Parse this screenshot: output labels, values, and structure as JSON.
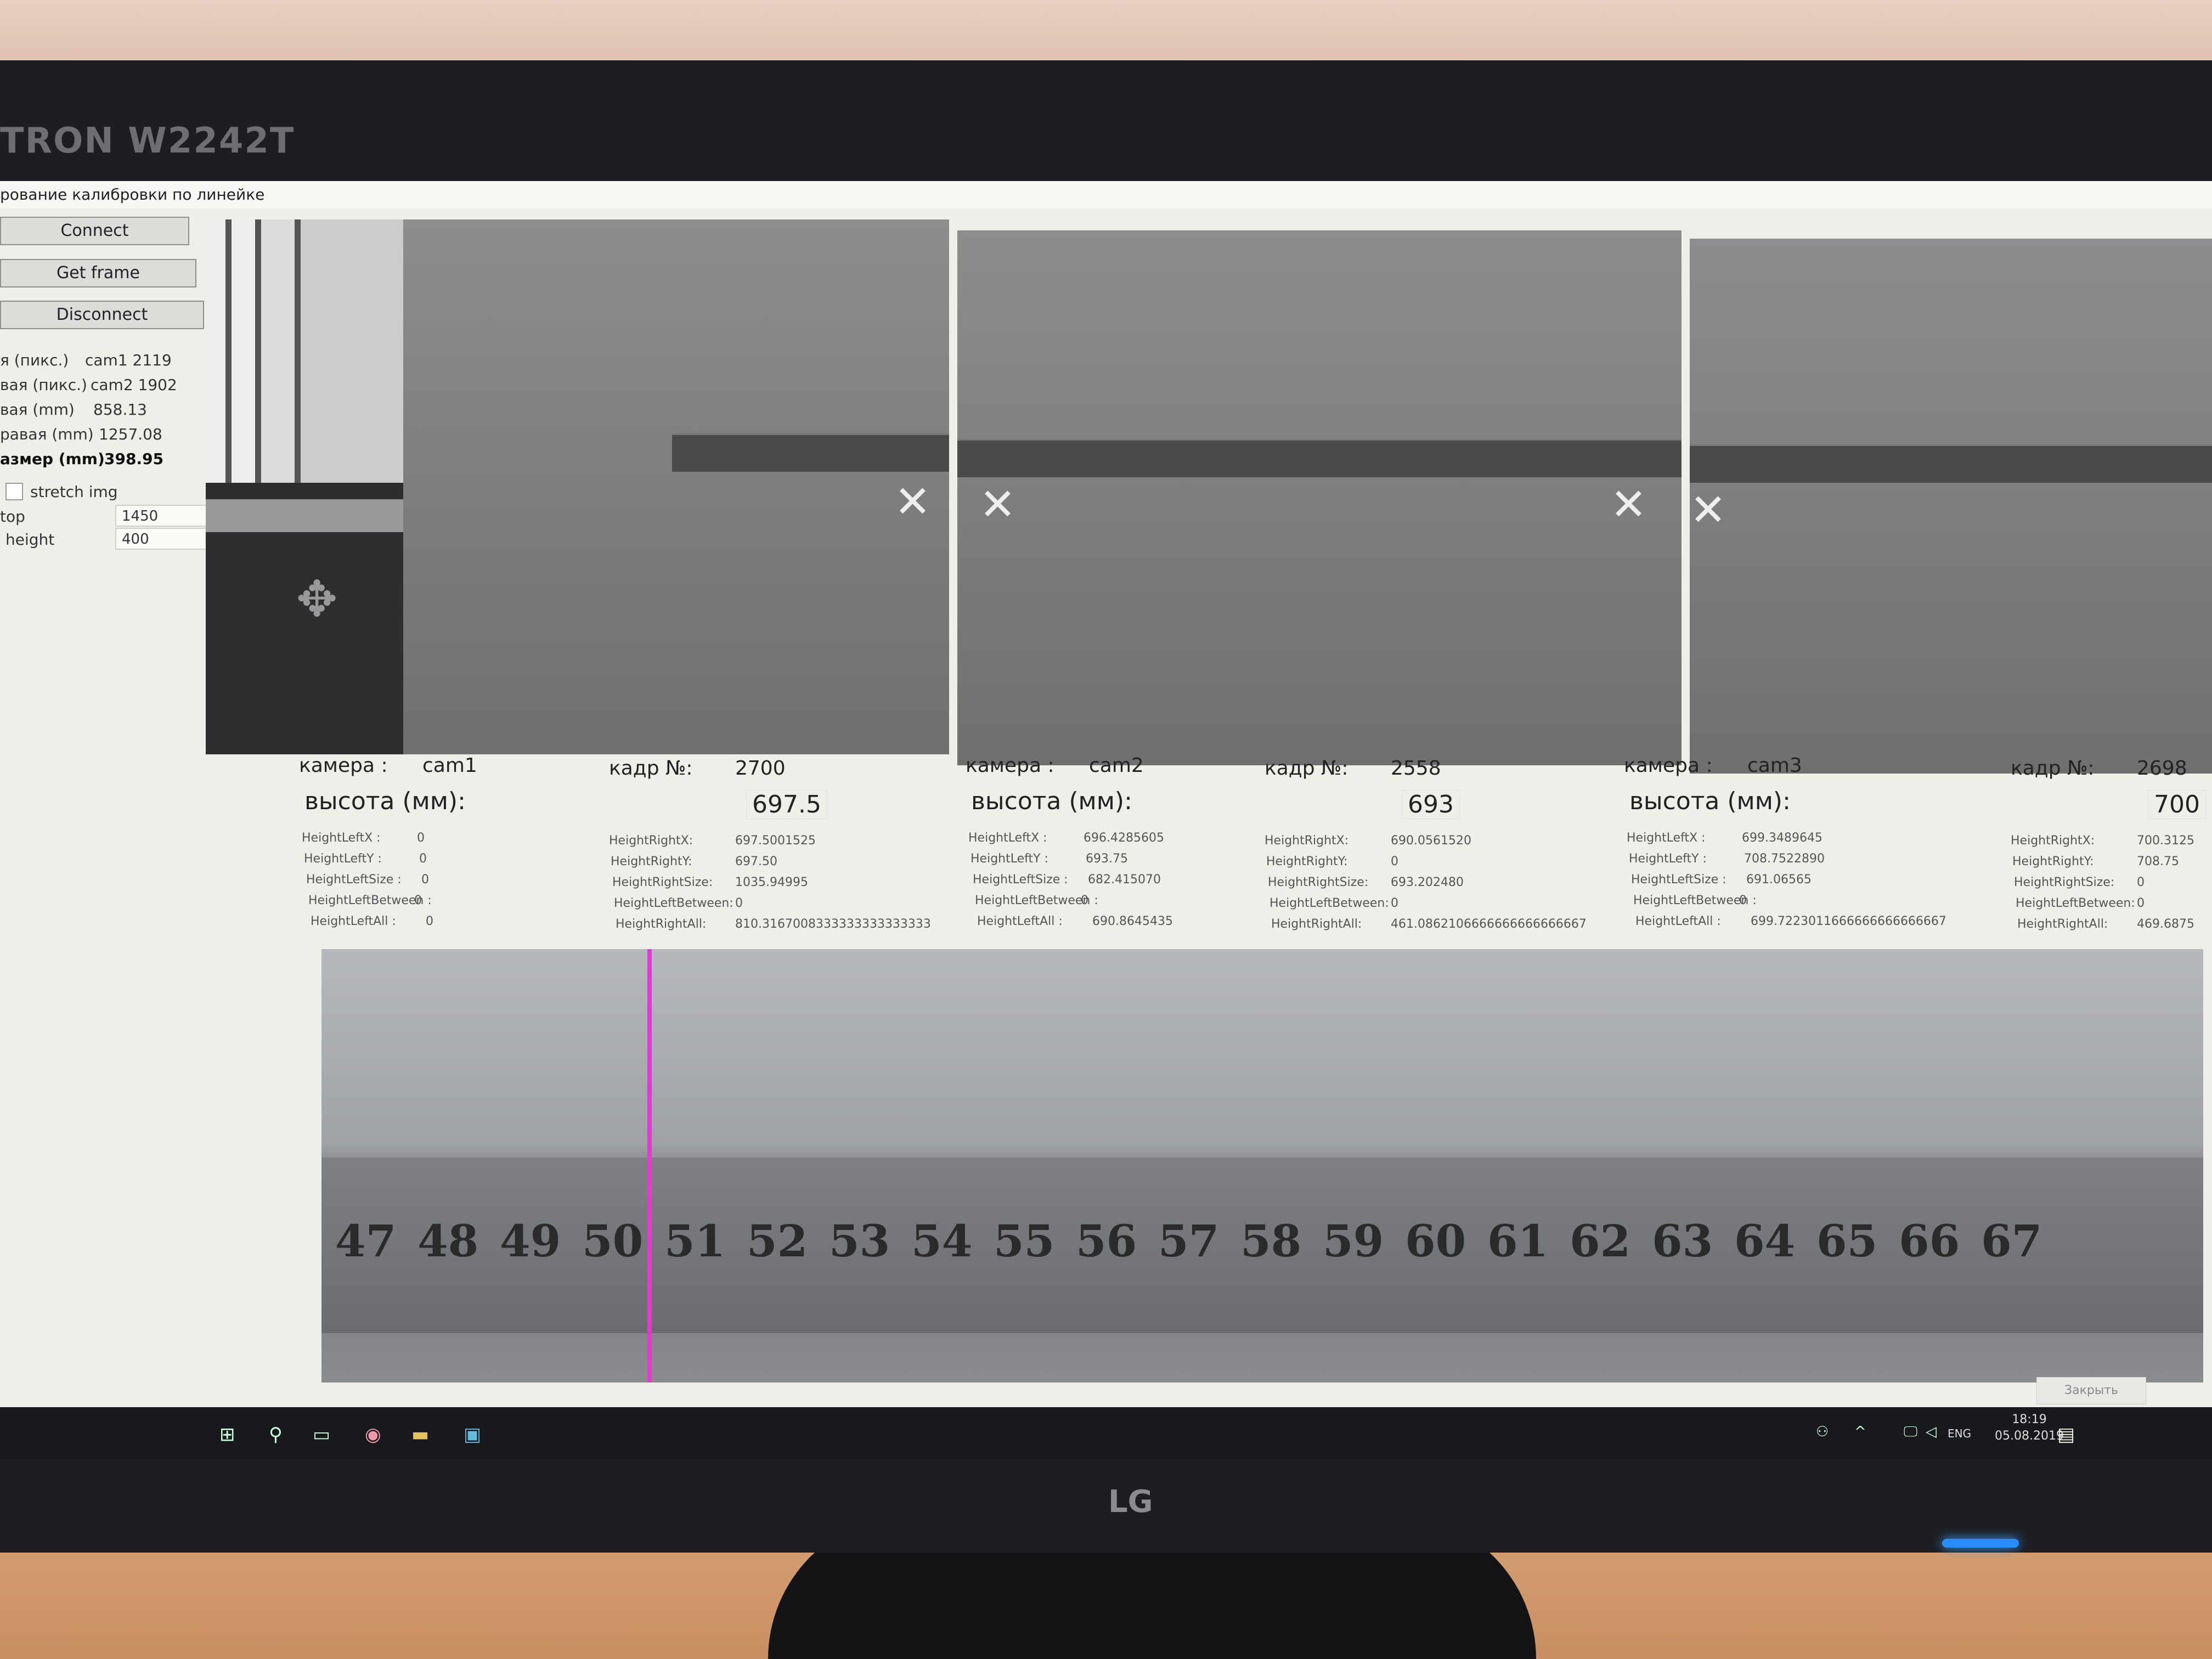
{
  "monitor": {
    "brand": "TRON W2242T",
    "logo": "LG"
  },
  "window": {
    "title": "рование калибровки по линейке"
  },
  "sidebar": {
    "buttons": [
      "Connect",
      "Get frame",
      "Disconnect"
    ],
    "fields": [
      {
        "label": "я (пикс.)",
        "value": "cam1 2119"
      },
      {
        "label": "вая (пикс.)",
        "value": "cam2 1902"
      },
      {
        "label": "вая (mm)",
        "value": "858.13"
      },
      {
        "label": "равая (mm)",
        "value": "1257.08"
      },
      {
        "label": "азмер (mm)",
        "value": "398.95"
      }
    ],
    "stretch_label": "stretch img",
    "stretch_checked": false,
    "top_label": "top",
    "top_value": "1450",
    "height_label": "height",
    "height_value": "400"
  },
  "cameras": [
    {
      "cam_label": "камера :",
      "cam": "cam1",
      "frame_label": "кадр №:",
      "frame": "2700",
      "height_label": "высота (мм):",
      "height": "697.5",
      "left": [
        [
          "HeightLeftX :",
          "0"
        ],
        [
          "HeightLeftY :",
          "0"
        ],
        [
          "HeightLeftSize :",
          "0"
        ],
        [
          "HeightLeftBetween :",
          "0"
        ],
        [
          "HeightLeftAll :",
          "0"
        ]
      ],
      "right": [
        [
          "HeightRightX:",
          "697.5001525"
        ],
        [
          "HeightRightY:",
          "697.50"
        ],
        [
          "HeightRightSize:",
          "1035.94995"
        ],
        [
          "HeightLeftBetween:",
          "0"
        ],
        [
          "HeightRightAll:",
          "810.3167008333333333333333"
        ]
      ]
    },
    {
      "cam_label": "камера :",
      "cam": "cam2",
      "frame_label": "кадр №:",
      "frame": "2558",
      "height_label": "высота (мм):",
      "height": "693",
      "left": [
        [
          "HeightLeftX :",
          "696.4285605"
        ],
        [
          "HeightLeftY :",
          "693.75"
        ],
        [
          "HeightLeftSize :",
          "682.415070"
        ],
        [
          "HeightLeftBetween :",
          "0"
        ],
        [
          "HeightLeftAll :",
          "690.8645435"
        ]
      ],
      "right": [
        [
          "HeightRightX:",
          "690.0561520"
        ],
        [
          "HeightRightY:",
          "0"
        ],
        [
          "HeightRightSize:",
          "693.202480"
        ],
        [
          "HeightLeftBetween:",
          "0"
        ],
        [
          "HeightRightAll:",
          "461.0862106666666666666667"
        ]
      ]
    },
    {
      "cam_label": "камера :",
      "cam": "cam3",
      "frame_label": "кадр №:",
      "frame": "2698",
      "height_label": "высота (мм):",
      "height": "700",
      "left": [
        [
          "HeightLeftX :",
          "699.3489645"
        ],
        [
          "HeightLeftY :",
          "708.7522890"
        ],
        [
          "HeightLeftSize :",
          "691.06565"
        ],
        [
          "HeightLeftBetween :",
          "0"
        ],
        [
          "HeightLeftAll :",
          "699.7223011666666666666667"
        ]
      ],
      "right": [
        [
          "HeightRightX:",
          "700.3125"
        ],
        [
          "HeightRightY:",
          "708.75"
        ],
        [
          "HeightRightSize:",
          "0"
        ],
        [
          "HeightLeftBetween:",
          "0"
        ],
        [
          "HeightRightAll:",
          "469.6875"
        ]
      ]
    }
  ],
  "ruler_numbers": [
    "47",
    "48",
    "49",
    "50",
    "51",
    "52",
    "53",
    "54",
    "55",
    "56",
    "57",
    "58",
    "59",
    "60",
    "61",
    "62",
    "63",
    "64",
    "65",
    "66",
    "67"
  ],
  "colors": {
    "marker_line": "#e23bd0"
  },
  "taskbar": {
    "close_label": "Закрыть",
    "lang": "ENG",
    "time": "18:19",
    "date": "05.08.2019"
  }
}
